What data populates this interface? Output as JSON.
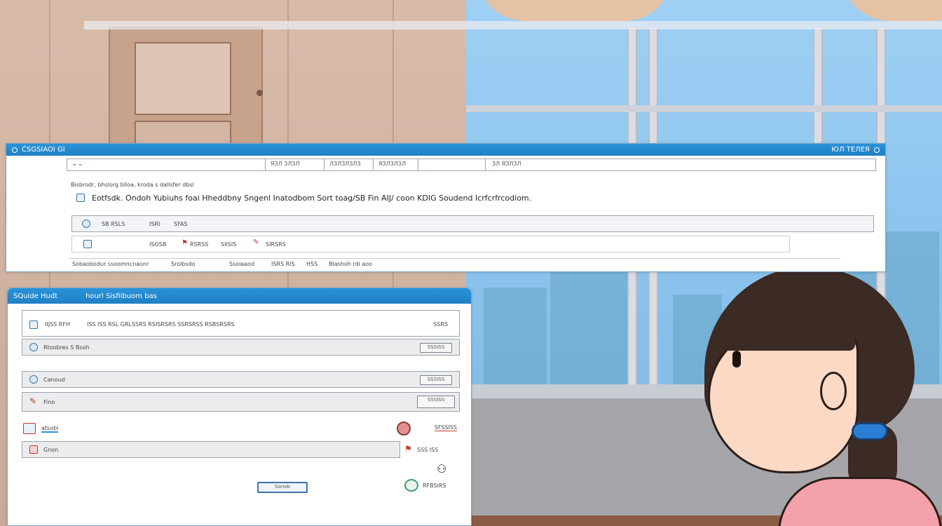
{
  "top_window": {
    "title": "ĊSGSIAOI GI",
    "title_right": "ЮЛ ТЕЛЕЯ",
    "menu": {
      "dropdown_icon": "chevron-down-icon",
      "col1": "ЯЗЛ ЗЛЗЛ",
      "col2": "ЛЗЛЗЛЗЛЗ",
      "col3": "ЯЗЛЗЛЗЛ",
      "col4": "ЗЛ ЯЗЛЗЛ"
    },
    "breadcrumb": "Bisbrodr, bhslorg blloa, kroda s dallsfer dbsl",
    "headline": "Eotfsdk. Ondoh Yubiuhs foai Hheddbny Sngenl Inatodbom Sort toag/SB Fin AIJ/ coon KDIG Soudend Icrfcrfrcodiom.",
    "toolbar_row": {
      "a": "SB RSLS",
      "b": "ISRI",
      "c": "SFAS"
    },
    "subrow": {
      "a": "ISOSB",
      "b": "RSRSS",
      "c": "SIISIS",
      "d": "SIRSRS"
    },
    "status": {
      "a": "Sobaobodur ssoomncnaonr",
      "b": "Srolbsdo",
      "c": "Ssolaaod",
      "d": "ISRS RIS",
      "e": "HSS",
      "f": "Blashoh rdi aoo"
    }
  },
  "left_sidebar": {
    "icons": [
      "user-icon",
      "folder-icon",
      "settings-icon"
    ]
  },
  "bottom_window": {
    "title": "SQuide Hudt",
    "title_center": "hourl Sisfiibuom bas",
    "rows": [
      {
        "icon": "document-icon",
        "label": "IIJSS RFH",
        "detail": "ISS ISS RSL GRLSSRS RSISRSRS SSRSRSS RSBSRSRS",
        "right": "SSRS"
      },
      {
        "icon": "globe-icon",
        "label": "Rtoobres S Bsoh",
        "button": "SSSISS"
      },
      {
        "icon": "clock-icon",
        "label": "Canoud",
        "button": "SSSISS"
      },
      {
        "icon": "pin-icon",
        "label": "Fino",
        "button": "SSSISS"
      },
      {
        "icon": "image-icon",
        "label": "atsobl",
        "right": "SFSSISS"
      },
      {
        "icon": "flag-icon",
        "label": "Gnon",
        "right": "SSS ISS"
      }
    ],
    "footer_right_icon": "person-icon",
    "action_button": "Sonob",
    "bottom_right_label": "RFBSIRS"
  },
  "colors": {
    "titlebar": "#1f7fc4",
    "accent": "#2a93d8",
    "wall": "#d8bba9",
    "sky": "#8cc4ee"
  }
}
